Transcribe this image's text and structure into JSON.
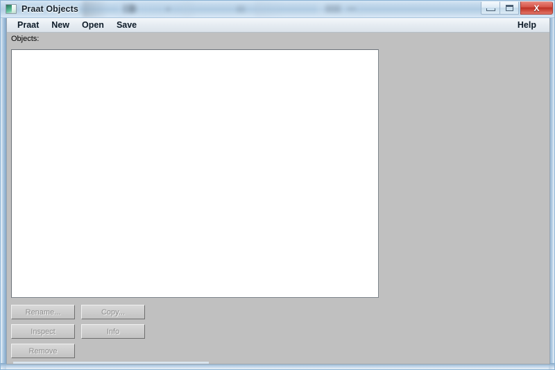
{
  "window": {
    "title": "Praat Objects",
    "icon": "praat-app-icon",
    "controls": {
      "minimize_label": "–",
      "maximize_label": "□",
      "close_label": "X"
    }
  },
  "menu_bar": {
    "left_items": [
      {
        "label": "Praat",
        "name": "menu-praat"
      },
      {
        "label": "New",
        "name": "menu-new"
      },
      {
        "label": "Open",
        "name": "menu-open"
      },
      {
        "label": "Save",
        "name": "menu-save"
      }
    ],
    "right_items": [
      {
        "label": "Help",
        "name": "menu-help"
      }
    ]
  },
  "objects_panel": {
    "label": "Objects:",
    "items": [],
    "empty": true
  },
  "action_buttons": {
    "rows": [
      [
        {
          "label": "Rename...",
          "name": "rename-button",
          "enabled": false
        },
        {
          "label": "Copy...",
          "name": "copy-button",
          "enabled": false
        }
      ],
      [
        {
          "label": "Inspect",
          "name": "inspect-button",
          "enabled": false
        },
        {
          "label": "Info",
          "name": "info-button",
          "enabled": false
        }
      ],
      [
        {
          "label": "Remove",
          "name": "remove-button",
          "enabled": false
        }
      ]
    ]
  },
  "dynamic_menu": {
    "items": [],
    "empty": true
  },
  "colors": {
    "client_background": "#c0c0c0",
    "list_background": "#ffffff",
    "title_bar_glass": "#b2cde4",
    "close_button_red": "#bb3125",
    "disabled_text": "#8e8e8e",
    "menu_text": "#0d1b28"
  }
}
